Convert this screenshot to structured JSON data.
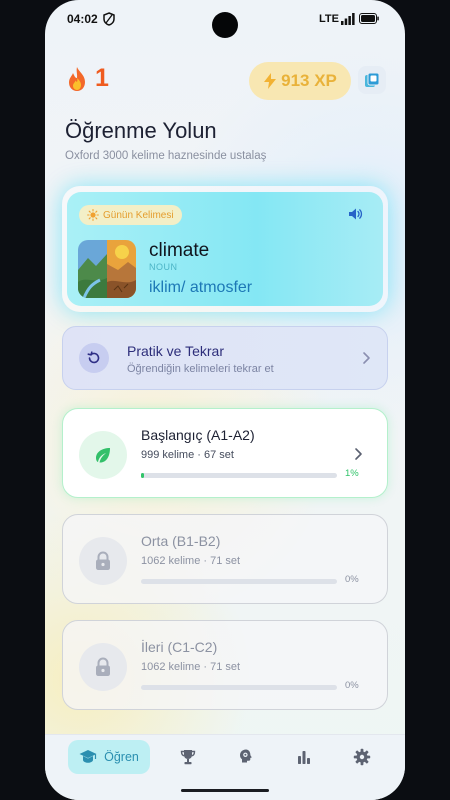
{
  "status": {
    "time": "04:02",
    "network": "LTE"
  },
  "header": {
    "streak": "1",
    "xp": "913 XP"
  },
  "page": {
    "title": "Öğrenme Yolun",
    "subtitle": "Oxford 3000 kelime haznesinde ustalaş"
  },
  "word_of_day": {
    "badge": "Günün Kelimesi",
    "word": "climate",
    "pos": "NOUN",
    "meaning": "iklim/ atmosfer"
  },
  "practice": {
    "title": "Pratik ve Tekrar",
    "subtitle": "Öğrendiğin kelimeleri tekrar et"
  },
  "levels": [
    {
      "title": "Başlangıç (A1-A2)",
      "meta": "999 kelime · 67 set",
      "progress_label": "1%",
      "progress": 0.01,
      "state": "active"
    },
    {
      "title": "Orta (B1-B2)",
      "meta": "1062 kelime · 71 set",
      "progress_label": "0%",
      "progress": 0,
      "state": "locked"
    },
    {
      "title": "İleri (C1-C2)",
      "meta": "1062 kelime · 71 set",
      "progress_label": "0%",
      "progress": 0,
      "state": "locked"
    }
  ],
  "nav": {
    "active_label": "Öğren"
  },
  "colors": {
    "accent": "#31c46a",
    "streak": "#ef5b1f",
    "xp": "#e9b23a",
    "practice": "#2d2e7a",
    "meaning": "#1d78b6"
  }
}
